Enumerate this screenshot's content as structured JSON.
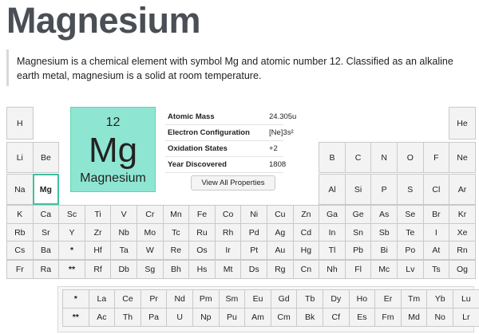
{
  "page": {
    "title": "Magnesium",
    "description": "Magnesium is a chemical element with symbol Mg and atomic number 12. Classified as an alkaline earth metal, magnesium is a solid at room temperature."
  },
  "selected": {
    "number": "12",
    "symbol": "Mg",
    "name": "Magnesium"
  },
  "properties": [
    {
      "label": "Atomic Mass",
      "value": "24.305u"
    },
    {
      "label": "Electron Configuration",
      "value": "[Ne]3s²"
    },
    {
      "label": "Oxidation States",
      "value": "+2"
    },
    {
      "label": "Year Discovered",
      "value": "1808"
    }
  ],
  "button": {
    "label": "View All Properties"
  },
  "colors": {
    "accent": "#8ee6d2",
    "selected_border": "#3fc0a1",
    "cell_bg": "#f3f3f3"
  },
  "rows": [
    [
      "H",
      "",
      "",
      "",
      "",
      "",
      "",
      "",
      "",
      "",
      "",
      "",
      "",
      "",
      "",
      "",
      "",
      "He"
    ],
    [
      "Li",
      "Be",
      "",
      "",
      "",
      "",
      "",
      "",
      "",
      "",
      "",
      "",
      "B",
      "C",
      "N",
      "O",
      "F",
      "Ne"
    ],
    [
      "Na",
      "Mg",
      "",
      "",
      "",
      "",
      "",
      "",
      "",
      "",
      "",
      "",
      "Al",
      "Si",
      "P",
      "S",
      "Cl",
      "Ar"
    ],
    [
      "K",
      "Ca",
      "Sc",
      "Ti",
      "V",
      "Cr",
      "Mn",
      "Fe",
      "Co",
      "Ni",
      "Cu",
      "Zn",
      "Ga",
      "Ge",
      "As",
      "Se",
      "Br",
      "Kr"
    ],
    [
      "Rb",
      "Sr",
      "Y",
      "Zr",
      "Nb",
      "Mo",
      "Tc",
      "Ru",
      "Rh",
      "Pd",
      "Ag",
      "Cd",
      "In",
      "Sn",
      "Sb",
      "Te",
      "I",
      "Xe"
    ],
    [
      "Cs",
      "Ba",
      "*",
      "Hf",
      "Ta",
      "W",
      "Re",
      "Os",
      "Ir",
      "Pt",
      "Au",
      "Hg",
      "Tl",
      "Pb",
      "Bi",
      "Po",
      "At",
      "Rn"
    ],
    [
      "Fr",
      "Ra",
      "**",
      "Rf",
      "Db",
      "Sg",
      "Bh",
      "Hs",
      "Mt",
      "Ds",
      "Rg",
      "Cn",
      "Nh",
      "Fl",
      "Mc",
      "Lv",
      "Ts",
      "Og"
    ]
  ],
  "f_rows": [
    [
      "*",
      "La",
      "Ce",
      "Pr",
      "Nd",
      "Pm",
      "Sm",
      "Eu",
      "Gd",
      "Tb",
      "Dy",
      "Ho",
      "Er",
      "Tm",
      "Yb",
      "Lu"
    ],
    [
      "**",
      "Ac",
      "Th",
      "Pa",
      "U",
      "Np",
      "Pu",
      "Am",
      "Cm",
      "Bk",
      "Cf",
      "Es",
      "Fm",
      "Md",
      "No",
      "Lr"
    ]
  ]
}
